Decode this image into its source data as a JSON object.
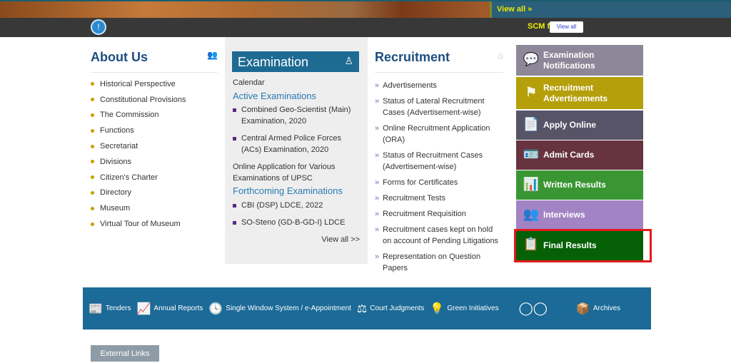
{
  "top": {
    "view_all": "View all »",
    "scm_text": "SCM f",
    "scm_button": "View all"
  },
  "about": {
    "title": "About Us",
    "items": [
      "Historical Perspective",
      "Constitutional Provisions",
      "The Commission",
      "Functions",
      "Secretariat",
      "Divisions",
      "Citizen's Charter",
      "Directory",
      "Museum",
      "Virtual Tour of Museum"
    ]
  },
  "exam": {
    "title": "Examination",
    "calendar": "Calendar",
    "active_title": "Active Examinations",
    "active": [
      "Combined Geo-Scientist (Main) Examination, 2020",
      "Central Armed Police Forces (ACs) Examination, 2020"
    ],
    "online_app": "Online Application for Various Examinations of UPSC",
    "forthcoming_title": "Forthcoming Examinations",
    "forthcoming": [
      "CBI (DSP) LDCE, 2022",
      "SO-Steno (GD-B-GD-I) LDCE"
    ],
    "view_all": "View all >>"
  },
  "recruitment": {
    "title": "Recruitment",
    "items": [
      "Advertisements",
      "Status of Lateral Recruitment Cases (Advertisement-wise)",
      "Online Recruitment Application (ORA)",
      "Status of Recruitment Cases (Advertisement-wise)",
      "Forms for Certificates",
      "Recruitment Tests",
      "Recruitment Requisition",
      "Recruitment cases kept on hold on account of Pending Litigations",
      "Representation on Question Papers"
    ]
  },
  "tiles": [
    {
      "label": "Examination Notifications",
      "color": "#8e8799",
      "icon": "chat-icon"
    },
    {
      "label": "Recruitment Advertisements",
      "color": "#b59f0b",
      "icon": "signboard-icon"
    },
    {
      "label": "Apply Online",
      "color": "#585468",
      "icon": "form-icon"
    },
    {
      "label": "Admit Cards",
      "color": "#67333f",
      "icon": "id-card-icon"
    },
    {
      "label": "Written Results",
      "color": "#3a9633",
      "icon": "bar-chart-icon"
    },
    {
      "label": "Interviews",
      "color": "#a283c4",
      "icon": "people-icon"
    },
    {
      "label": "Final Results",
      "color": "#056006",
      "icon": "clipboard-check-icon"
    }
  ],
  "highlight_color": "#e21a1a",
  "footer": {
    "items": [
      "Tenders",
      "Annual Reports",
      "Single Window System / e-Appointment",
      "Court Judgments",
      "Green Initiatives",
      "Archives"
    ],
    "swachh_logo": "स्वच्छ भारत एक कदम स्वच्छता की ओर"
  },
  "external_links": "External Links"
}
